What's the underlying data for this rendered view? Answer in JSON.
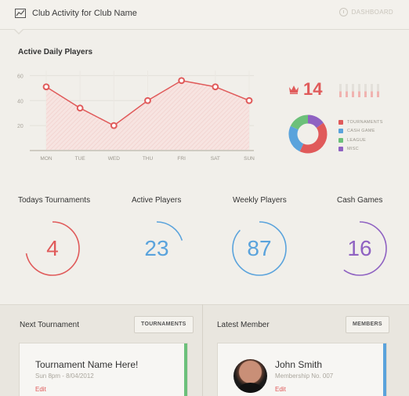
{
  "header": {
    "title": "Club Activity for Club Name",
    "dashboard_label": "DASHBOARD"
  },
  "active_daily": {
    "title": "Active Daily Players",
    "chart_data": {
      "type": "line",
      "categories": [
        "MON",
        "TUE",
        "WED",
        "THU",
        "FRI",
        "SAT",
        "SUN"
      ],
      "values": [
        51,
        34,
        20,
        40,
        56,
        51,
        40
      ],
      "yticks": [
        20,
        40,
        60
      ],
      "ylim": [
        0,
        64
      ],
      "grid": true,
      "color": "#e05a5a"
    }
  },
  "summary": {
    "value": "14",
    "legend": [
      {
        "label": "TOURNAMENTS",
        "color": "#e05a5a",
        "share": 0.42
      },
      {
        "label": "CASH GAME",
        "color": "#5aa3dc",
        "share": 0.25
      },
      {
        "label": "LEAGUE",
        "color": "#6cc07a",
        "share": 0.18
      },
      {
        "label": "MISC",
        "color": "#8f62c2",
        "share": 0.15
      }
    ],
    "mini_bars": [
      0.45,
      0.45,
      0.45,
      0.45,
      0.45,
      0.45,
      0.45
    ]
  },
  "stats": [
    {
      "label": "Todays Tournaments",
      "value": "4",
      "color": "#e05a5a",
      "progress": 0.72
    },
    {
      "label": "Active Players",
      "value": "23",
      "color": "#5aa3dc",
      "progress": 0.2
    },
    {
      "label": "Weekly Players",
      "value": "87",
      "color": "#5aa3dc",
      "progress": 0.87
    },
    {
      "label": "Cash Games",
      "value": "16",
      "color": "#8f62c2",
      "progress": 0.6
    }
  ],
  "next_tournament": {
    "title": "Next Tournament",
    "button": "TOURNAMENTS",
    "card_title": "Tournament Name Here!",
    "card_sub": "Sun 8pm - 8/04/2012",
    "link": "Edit",
    "accent": "#6cc07a"
  },
  "latest_member": {
    "title": "Latest Member",
    "button": "MEMBERS",
    "card_title": "John Smith",
    "card_sub": "Membership No. 007",
    "link": "Edit",
    "accent": "#5aa3dc"
  }
}
